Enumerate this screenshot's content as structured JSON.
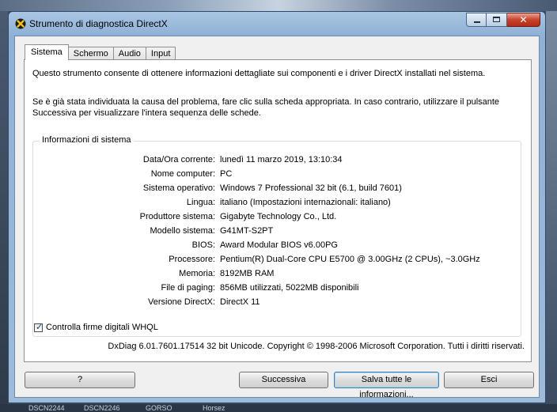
{
  "window": {
    "title": "Strumento di diagnostica DirectX",
    "close_glyph": "✕"
  },
  "tabs": [
    {
      "label": "Sistema",
      "active": true
    },
    {
      "label": "Schermo",
      "active": false
    },
    {
      "label": "Audio",
      "active": false
    },
    {
      "label": "Input",
      "active": false
    }
  ],
  "intro": {
    "line1": "Questo strumento consente di ottenere informazioni dettagliate sui componenti e i driver DirectX installati nel sistema.",
    "line2": "Se è già stata individuata la causa del problema, fare clic sulla scheda appropriata. In caso contrario, utilizzare il pulsante Successiva per visualizzare l'intera sequenza delle schede."
  },
  "system_info": {
    "title": "Informazioni di sistema",
    "rows": [
      {
        "label": "Data/Ora corrente:",
        "value": "lunedì 11 marzo 2019, 13:10:34"
      },
      {
        "label": "Nome computer:",
        "value": "PC"
      },
      {
        "label": "Sistema operativo:",
        "value": "Windows 7 Professional 32 bit (6.1, build 7601)"
      },
      {
        "label": "Lingua:",
        "value": "italiano (Impostazioni internazionali: italiano)"
      },
      {
        "label": "Produttore sistema:",
        "value": "Gigabyte Technology Co., Ltd."
      },
      {
        "label": "Modello sistema:",
        "value": "G41MT-S2PT"
      },
      {
        "label": "BIOS:",
        "value": "Award Modular BIOS v6.00PG"
      },
      {
        "label": "Processore:",
        "value": "Pentium(R) Dual-Core  CPU      E5700  @ 3.00GHz (2 CPUs), ~3.0GHz"
      },
      {
        "label": "Memoria:",
        "value": "8192MB RAM"
      },
      {
        "label": "File di paging:",
        "value": "856MB utilizzati, 5022MB disponibili"
      },
      {
        "label": "Versione DirectX:",
        "value": "DirectX 11"
      }
    ]
  },
  "whql": {
    "label": "Controlla firme digitali WHQL",
    "checked": true
  },
  "footer": "DxDiag 6.01.7601.17514 32 bit Unicode. Copyright © 1998-2006 Microsoft Corporation. Tutti i diritti riservati.",
  "buttons": {
    "help": "?",
    "next": "Successiva",
    "save": "Salva tutte le informazioni...",
    "exit": "Esci"
  },
  "desktop": {
    "taskbar_items": [
      "DSCN2244",
      "DSCN2246",
      "GORSO",
      "Horsez"
    ]
  }
}
